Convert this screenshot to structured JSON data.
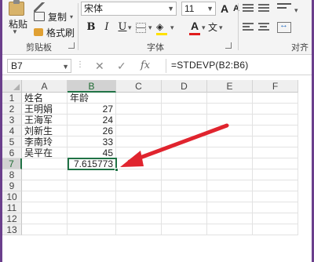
{
  "ribbon": {
    "paste_label": "粘贴",
    "cut_label": "",
    "copy_label": "复制",
    "format_painter_label": "格式刷",
    "clipboard_group": "剪贴板",
    "font_name": "宋体",
    "font_size": "11",
    "grow_font": "A",
    "shrink_font": "A",
    "bold": "B",
    "italic": "I",
    "underline": "U",
    "font_color_glyph": "A",
    "phonetic_glyph": "文",
    "font_group": "字体",
    "align_group": "对齐"
  },
  "formula_bar": {
    "name_box": "B7",
    "formula": "=STDEVP(B2:B6)"
  },
  "grid": {
    "columns": [
      "A",
      "B",
      "C",
      "D",
      "E",
      "F"
    ],
    "active_column": "B",
    "rows": [
      "1",
      "2",
      "3",
      "4",
      "5",
      "6",
      "7",
      "8",
      "9",
      "10",
      "11",
      "12",
      "13"
    ],
    "active_row": "7",
    "cells": {
      "A1": "姓名",
      "B1": "年龄",
      "A2": "王明娟",
      "B2": "27",
      "A3": "王海军",
      "B3": "24",
      "A4": "刘新生",
      "B4": "26",
      "A5": "李南玲",
      "B5": "33",
      "A6": "吴平在",
      "B6": "45",
      "B7": "7.615773"
    }
  },
  "annotation": {
    "arrow_color": "#e0242e"
  }
}
